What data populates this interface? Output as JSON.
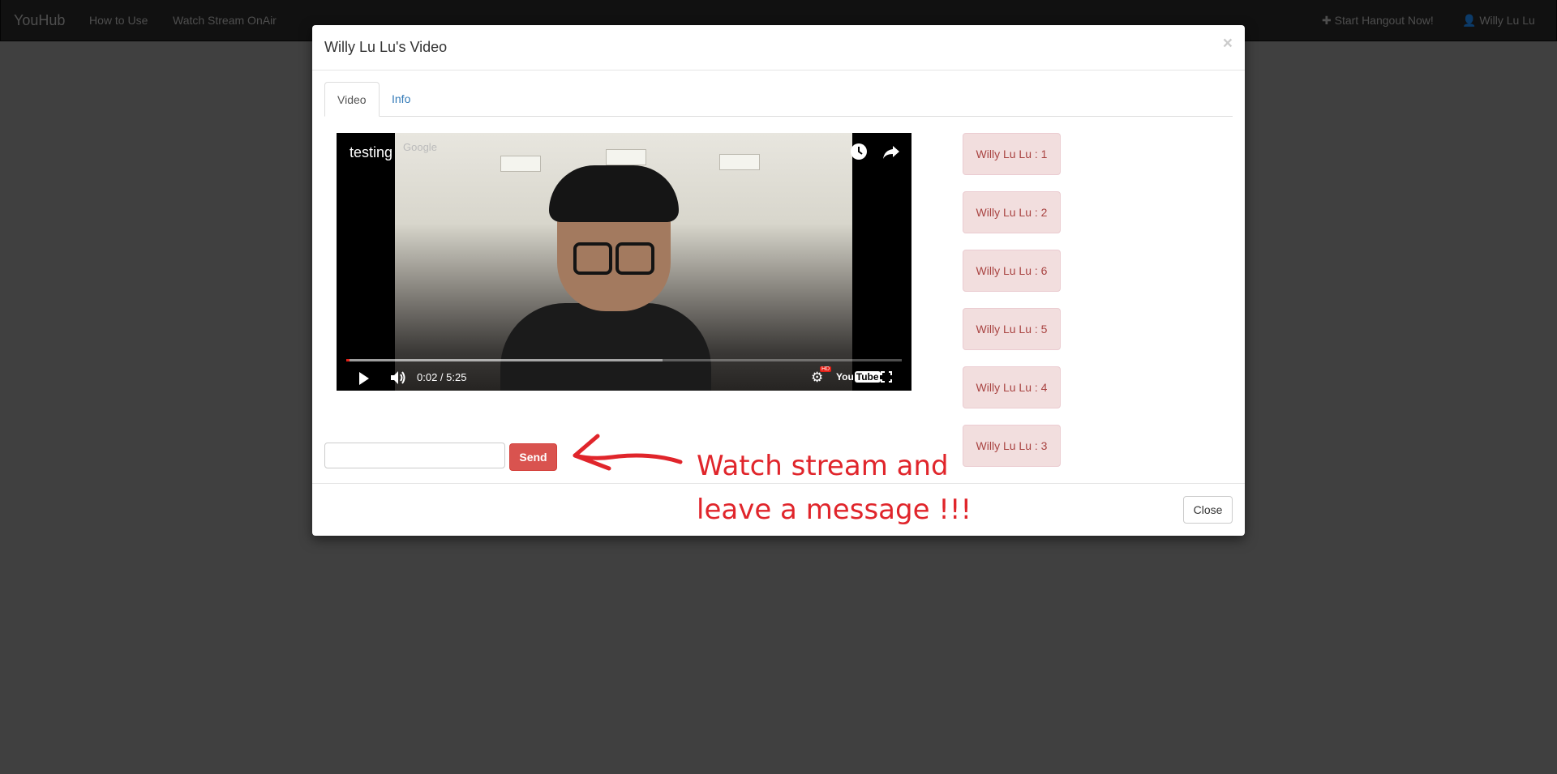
{
  "navbar": {
    "brand": "YouHub",
    "links": [
      "How to Use",
      "Watch Stream OnAir"
    ],
    "right": {
      "hangout": "✚ Start Hangout Now!",
      "user": "👤 Willy Lu Lu"
    }
  },
  "modal": {
    "title": "Willy Lu Lu's Video",
    "close_x": "×",
    "tabs": [
      {
        "label": "Video",
        "active": true
      },
      {
        "label": "Info",
        "active": false
      }
    ],
    "video": {
      "title": "testing",
      "watermark": "Google",
      "time": "0:02 / 5:25",
      "progress": 0.006,
      "buffered": 0.57,
      "icons": [
        "clock-icon",
        "share-icon",
        "play-icon",
        "volume-icon",
        "settings-icon",
        "youtube-logo",
        "fullscreen-icon"
      ]
    },
    "messages": [
      "Willy Lu Lu : 1",
      "Willy Lu Lu : 2",
      "Willy Lu Lu : 6",
      "Willy Lu Lu : 5",
      "Willy Lu Lu : 4",
      "Willy Lu Lu : 3"
    ],
    "message_input": {
      "value": "",
      "placeholder": ""
    },
    "send_label": "Send",
    "footer_close": "Close"
  },
  "annotation": {
    "line1": "Watch stream and",
    "line2": "leave a message !!!",
    "color": "#e0252b"
  },
  "colors": {
    "danger": "#d9534f",
    "alert_bg": "#f2dede",
    "alert_text": "#a94442",
    "link": "#337ab7",
    "navbar": "#222222"
  }
}
